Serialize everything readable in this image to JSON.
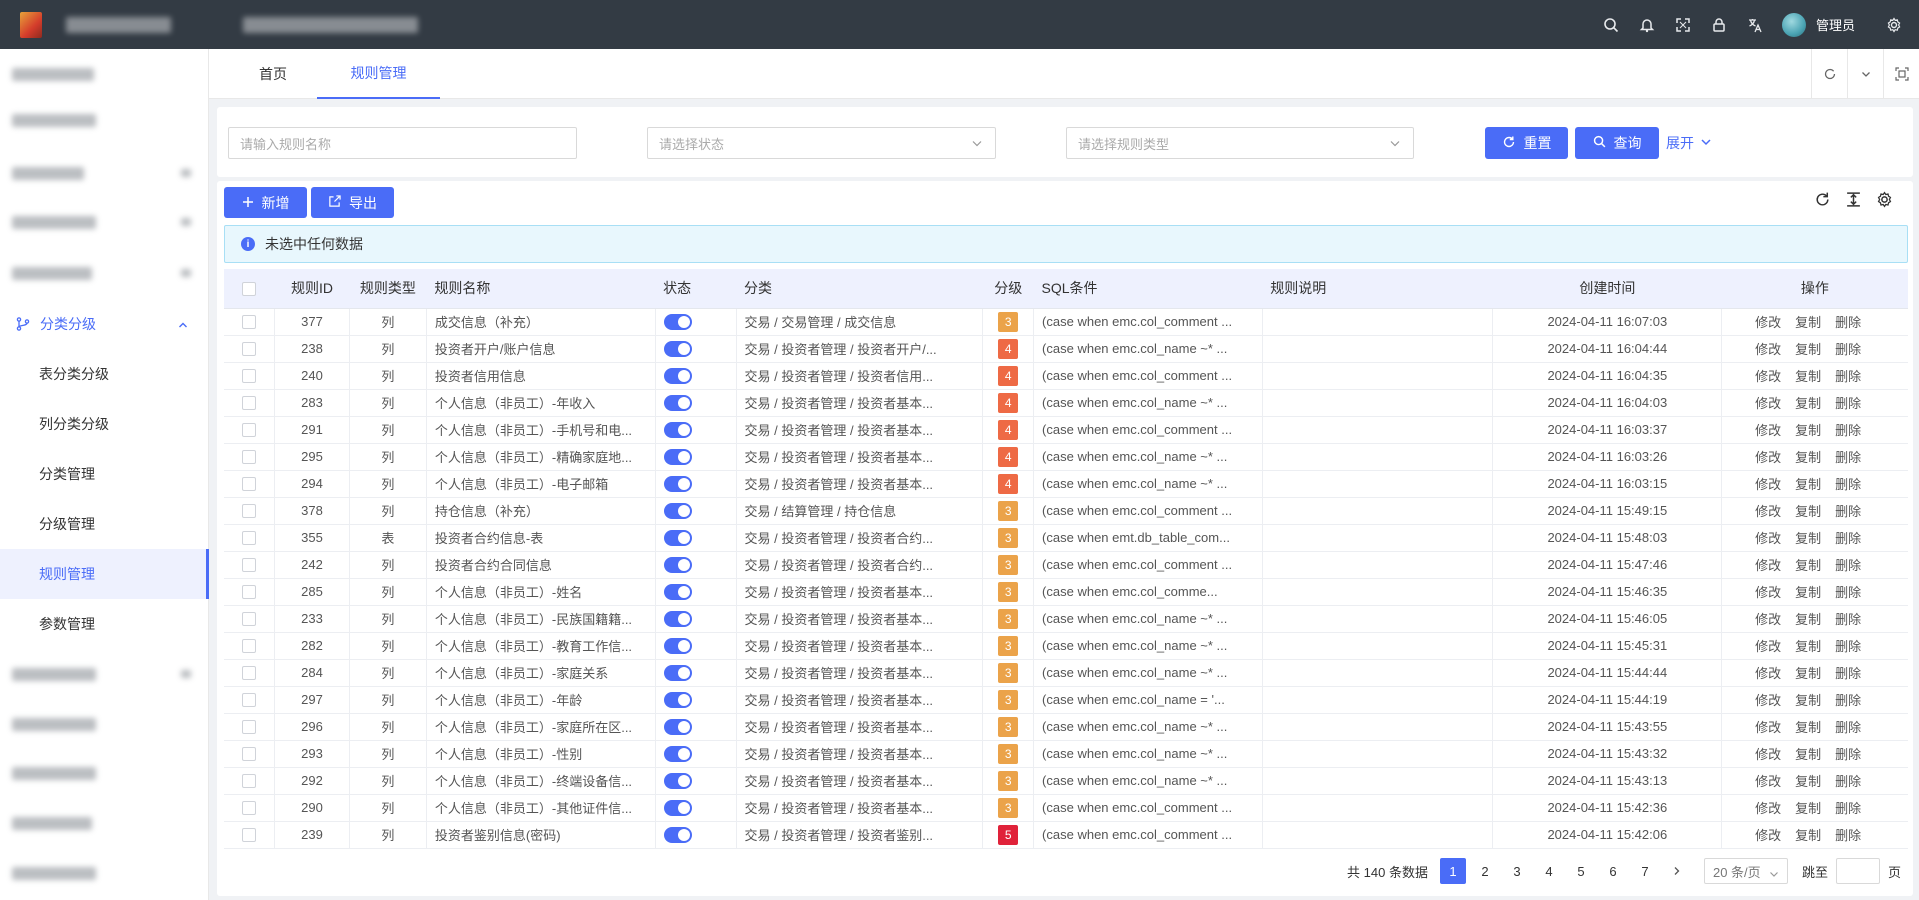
{
  "header": {
    "user_name": "管理员",
    "icons": [
      "search-icon",
      "bell-icon",
      "fullscreen-icon",
      "lock-icon",
      "translate-icon",
      "settings-icon"
    ]
  },
  "sidebar": {
    "group": {
      "label": "分类分级",
      "icon": "branch-icon"
    },
    "items": [
      {
        "label": "表分类分级"
      },
      {
        "label": "列分类分级"
      },
      {
        "label": "分类管理"
      },
      {
        "label": "分级管理"
      },
      {
        "label": "规则管理",
        "active": true
      },
      {
        "label": "参数管理"
      }
    ]
  },
  "tabs": [
    {
      "label": "首页"
    },
    {
      "label": "规则管理",
      "active": true
    }
  ],
  "filters": {
    "name_placeholder": "请输入规则名称",
    "status_placeholder": "请选择状态",
    "type_placeholder": "请选择规则类型",
    "reset_label": "重置",
    "query_label": "查询",
    "expand_label": "展开"
  },
  "toolbar": {
    "add_label": "新增",
    "export_label": "导出"
  },
  "alert_text": "未选中任何数据",
  "table": {
    "columns": [
      "规则ID",
      "规则类型",
      "规则名称",
      "状态",
      "分类",
      "分级",
      "SQL条件",
      "规则说明",
      "创建时间",
      "操作"
    ],
    "actions": [
      "修改",
      "复制",
      "删除"
    ],
    "level_colors": {
      "3": "#eba34a",
      "4": "#ee6a45",
      "5": "#e0223a"
    },
    "rows": [
      {
        "id": "377",
        "type": "列",
        "name": "成交信息（补充）",
        "category": "交易 / 交易管理 / 成交信息",
        "level": "3",
        "sql": "(case when emc.col_comment ...",
        "desc": "",
        "created": "2024-04-11 16:07:03"
      },
      {
        "id": "238",
        "type": "列",
        "name": "投资者开户/账户信息",
        "category": "交易 / 投资者管理 / 投资者开户/...",
        "level": "4",
        "sql": "(case when emc.col_name ~* ...",
        "desc": "",
        "created": "2024-04-11 16:04:44"
      },
      {
        "id": "240",
        "type": "列",
        "name": "投资者信用信息",
        "category": "交易 / 投资者管理 / 投资者信用...",
        "level": "4",
        "sql": "(case when emc.col_comment ...",
        "desc": "",
        "created": "2024-04-11 16:04:35"
      },
      {
        "id": "283",
        "type": "列",
        "name": "个人信息（非员工）-年收入",
        "category": "交易 / 投资者管理 / 投资者基本...",
        "level": "4",
        "sql": "(case when emc.col_name ~* ...",
        "desc": "",
        "created": "2024-04-11 16:04:03"
      },
      {
        "id": "291",
        "type": "列",
        "name": "个人信息（非员工）-手机号和电...",
        "category": "交易 / 投资者管理 / 投资者基本...",
        "level": "4",
        "sql": "(case when emc.col_comment ...",
        "desc": "",
        "created": "2024-04-11 16:03:37"
      },
      {
        "id": "295",
        "type": "列",
        "name": "个人信息（非员工）-精确家庭地...",
        "category": "交易 / 投资者管理 / 投资者基本...",
        "level": "4",
        "sql": "(case when emc.col_name ~* ...",
        "desc": "",
        "created": "2024-04-11 16:03:26"
      },
      {
        "id": "294",
        "type": "列",
        "name": "个人信息（非员工）-电子邮箱",
        "category": "交易 / 投资者管理 / 投资者基本...",
        "level": "4",
        "sql": "(case when emc.col_name ~* ...",
        "desc": "",
        "created": "2024-04-11 16:03:15"
      },
      {
        "id": "378",
        "type": "列",
        "name": "持仓信息（补充）",
        "category": "交易 / 结算管理 / 持仓信息",
        "level": "3",
        "sql": "(case when emc.col_comment ...",
        "desc": "",
        "created": "2024-04-11 15:49:15"
      },
      {
        "id": "355",
        "type": "表",
        "name": "投资者合约信息-表",
        "category": "交易 / 投资者管理 / 投资者合约...",
        "level": "3",
        "sql": "(case when emt.db_table_com...",
        "desc": "",
        "created": "2024-04-11 15:48:03"
      },
      {
        "id": "242",
        "type": "列",
        "name": "投资者合约合同信息",
        "category": "交易 / 投资者管理 / 投资者合约...",
        "level": "3",
        "sql": "(case when emc.col_comment ...",
        "desc": "",
        "created": "2024-04-11 15:47:46"
      },
      {
        "id": "285",
        "type": "列",
        "name": "个人信息（非员工）-姓名",
        "category": "交易 / 投资者管理 / 投资者基本...",
        "level": "3",
        "sql": "(case when emc.col_comme...",
        "desc": "",
        "created": "2024-04-11 15:46:35"
      },
      {
        "id": "233",
        "type": "列",
        "name": "个人信息（非员工）-民族国籍籍...",
        "category": "交易 / 投资者管理 / 投资者基本...",
        "level": "3",
        "sql": "(case when emc.col_name ~* ...",
        "desc": "",
        "created": "2024-04-11 15:46:05"
      },
      {
        "id": "282",
        "type": "列",
        "name": "个人信息（非员工）-教育工作信...",
        "category": "交易 / 投资者管理 / 投资者基本...",
        "level": "3",
        "sql": "(case when emc.col_name ~* ...",
        "desc": "",
        "created": "2024-04-11 15:45:31"
      },
      {
        "id": "284",
        "type": "列",
        "name": "个人信息（非员工）-家庭关系",
        "category": "交易 / 投资者管理 / 投资者基本...",
        "level": "3",
        "sql": "(case when emc.col_name ~* ...",
        "desc": "",
        "created": "2024-04-11 15:44:44"
      },
      {
        "id": "297",
        "type": "列",
        "name": "个人信息（非员工）-年龄",
        "category": "交易 / 投资者管理 / 投资者基本...",
        "level": "3",
        "sql": "(case when emc.col_name = '...",
        "desc": "",
        "created": "2024-04-11 15:44:19"
      },
      {
        "id": "296",
        "type": "列",
        "name": "个人信息（非员工）-家庭所在区...",
        "category": "交易 / 投资者管理 / 投资者基本...",
        "level": "3",
        "sql": "(case when emc.col_name ~* ...",
        "desc": "",
        "created": "2024-04-11 15:43:55"
      },
      {
        "id": "293",
        "type": "列",
        "name": "个人信息（非员工）-性别",
        "category": "交易 / 投资者管理 / 投资者基本...",
        "level": "3",
        "sql": "(case when emc.col_name ~* ...",
        "desc": "",
        "created": "2024-04-11 15:43:32"
      },
      {
        "id": "292",
        "type": "列",
        "name": "个人信息（非员工）-终端设备信...",
        "category": "交易 / 投资者管理 / 投资者基本...",
        "level": "3",
        "sql": "(case when emc.col_name ~* ...",
        "desc": "",
        "created": "2024-04-11 15:43:13"
      },
      {
        "id": "290",
        "type": "列",
        "name": "个人信息（非员工）-其他证件信...",
        "category": "交易 / 投资者管理 / 投资者基本...",
        "level": "3",
        "sql": "(case when emc.col_comment ...",
        "desc": "",
        "created": "2024-04-11 15:42:36"
      },
      {
        "id": "239",
        "type": "列",
        "name": "投资者鉴别信息(密码)",
        "category": "交易 / 投资者管理 / 投资者鉴别...",
        "level": "5",
        "sql": "(case when emc.col_comment ...",
        "desc": "",
        "created": "2024-04-11 15:42:06"
      }
    ]
  },
  "pagination": {
    "total_text": "共 140 条数据",
    "pages": [
      "1",
      "2",
      "3",
      "4",
      "5",
      "6",
      "7"
    ],
    "current": "1",
    "page_size": "20 条/页",
    "jump_label": "跳至",
    "page_suffix": "页"
  }
}
